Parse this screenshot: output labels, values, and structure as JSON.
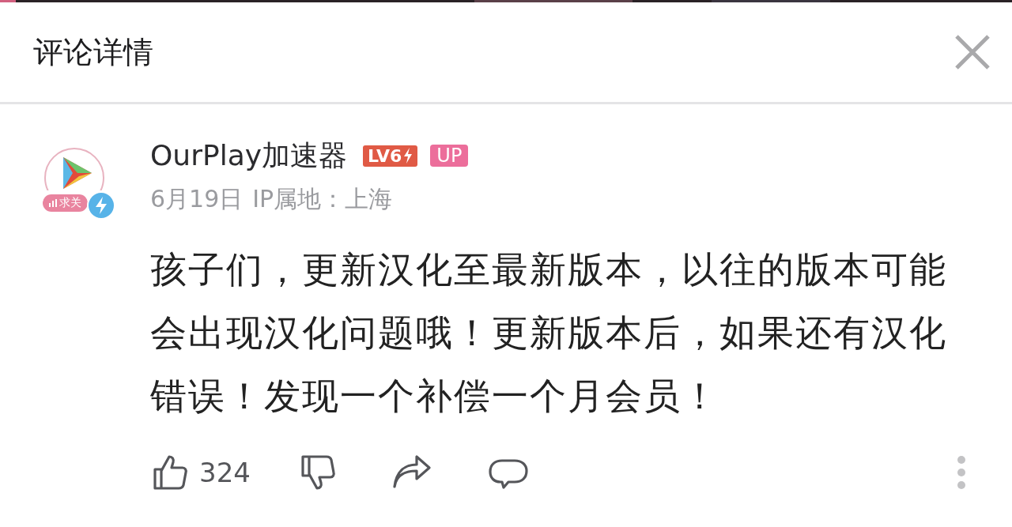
{
  "header": {
    "title": "评论详情"
  },
  "comment": {
    "avatar_tag": "求关",
    "author": "OurPlay加速器",
    "level_badge": "LV6",
    "up_badge": "UP",
    "date": "6月19日",
    "ip_location": "IP属地：上海",
    "text": "孩子们，更新汉化至最新版本，以往的版本可能会出现汉化问题哦！更新版本后，如果还有汉化错误！发现一个补偿一个月会员！",
    "like_count": "324"
  }
}
